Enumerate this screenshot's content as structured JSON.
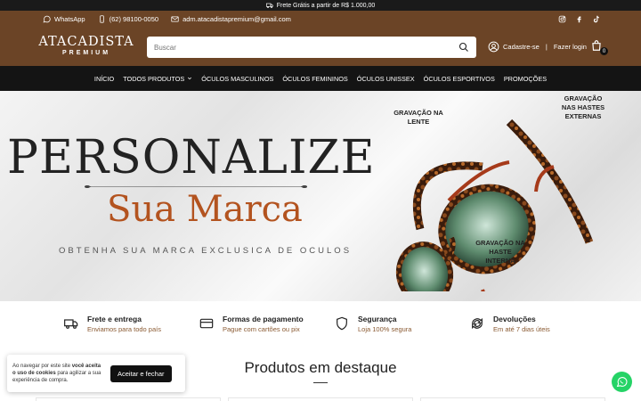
{
  "topbar": {
    "text": "Frete Grátis a partir de R$ 1.000,00"
  },
  "header": {
    "whatsapp": "WhatsApp",
    "phone": "(62) 98100-0050",
    "email": "adm.atacadistapremium@gmail.com",
    "logo_main": "ATACADISTA",
    "logo_sub": "PREMIUM",
    "search_placeholder": "Buscar",
    "signup": "Cadastre-se",
    "separator": "|",
    "login": "Fazer login",
    "cart_count": "0"
  },
  "nav": {
    "items": [
      {
        "label": "INÍCIO"
      },
      {
        "label": "TODOS PRODUTOS"
      },
      {
        "label": "ÓCULOS MASCULINOS"
      },
      {
        "label": "ÓCULOS FEMININOS"
      },
      {
        "label": "ÓCULOS UNISSEX"
      },
      {
        "label": "ÓCULOS ESPORTIVOS"
      },
      {
        "label": "PROMOÇÕES"
      }
    ]
  },
  "banner": {
    "title": "PERSONALIZE",
    "subtitle": "Sua Marca",
    "tagline": "OBTENHA SUA MARCA EXCLUSICA DE OCULOS",
    "label_lens": "GRAVAÇÃO NA LENTE",
    "label_external": "GRAVAÇÃO NAS HASTES EXTERNAS",
    "label_internal": "GRAVAÇÃO NA HASTE INTERNA"
  },
  "features": [
    {
      "title": "Frete e entrega",
      "subtitle": "Enviamos para todo país",
      "icon": "truck-icon"
    },
    {
      "title": "Formas de pagamento",
      "subtitle": "Pague com cartões ou pix",
      "icon": "credit-card-icon"
    },
    {
      "title": "Segurança",
      "subtitle": "Loja 100% segura",
      "icon": "shield-icon"
    },
    {
      "title": "Devoluções",
      "subtitle": "Em até 7 dias úteis",
      "icon": "refresh-icon"
    }
  ],
  "products": {
    "title": "Produtos em destaque"
  },
  "cookie": {
    "text_start": "Ao navegar por este site ",
    "text_bold": "você aceita o uso de cookies",
    "text_end": " para agilizar a sua experiência de compra.",
    "button": "Aceitar e fechar"
  },
  "colors": {
    "header_bg": "#6b4426",
    "nav_bg": "#141414",
    "accent": "#b3531f",
    "whatsapp": "#25d366"
  }
}
